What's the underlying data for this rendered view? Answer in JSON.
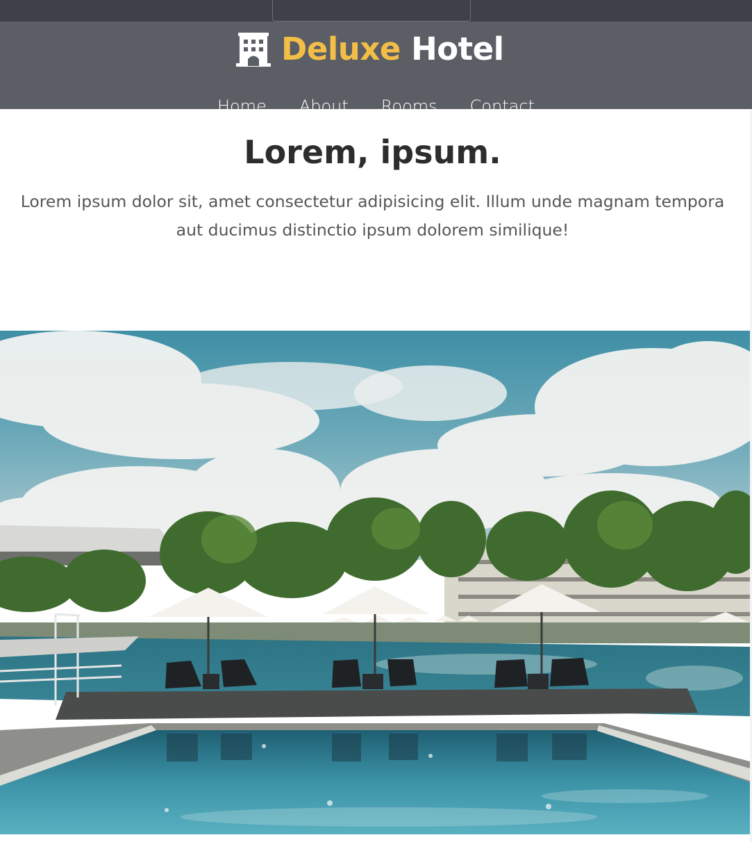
{
  "brand": {
    "icon": "hotel-building-icon",
    "accent_word": "Deluxe",
    "main_word": "Hotel",
    "accent_color": "#f2be48"
  },
  "nav": {
    "items": [
      {
        "label": "Home"
      },
      {
        "label": "About"
      },
      {
        "label": "Rooms"
      },
      {
        "label": "Contact"
      }
    ]
  },
  "intro": {
    "title": "Lorem, ipsum.",
    "text": "Lorem ipsum dolor sit, amet consectetur adipisicing elit. Illum unde magnam tempora aut ducimus distinctio ipsum dolorem similique!"
  },
  "colors": {
    "header_bg": "#5b5e64",
    "header_top_bg": "#3e4149",
    "heading_text": "#2d2d2d",
    "body_text": "#555555"
  }
}
